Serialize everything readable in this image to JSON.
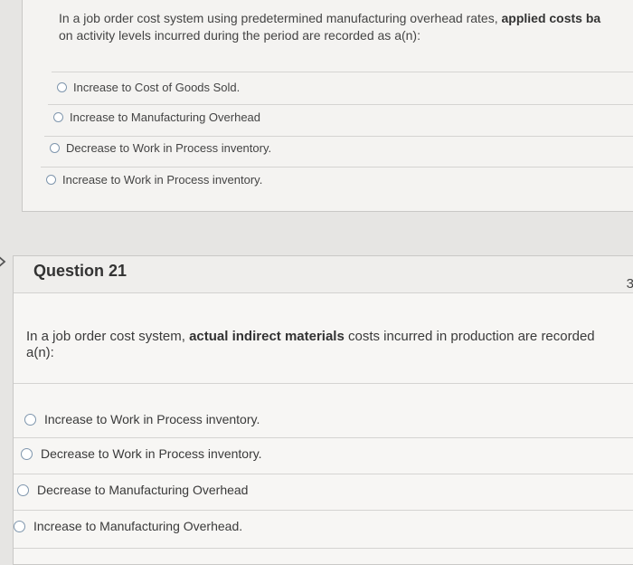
{
  "q20": {
    "prompt_part1": "In a job order cost system using predetermined manufacturing overhead rates, ",
    "prompt_bold": "applied costs ba",
    "prompt_part2": "on activity levels incurred during the period are recorded as a(n):",
    "options": [
      "Increase to Cost of Goods Sold.",
      "Increase to Manufacturing Overhead",
      "Decrease to Work in Process inventory.",
      "Increase to Work in Process inventory."
    ]
  },
  "q21": {
    "title": "Question 21",
    "points": "3",
    "prompt_part1": "In a job order cost system, ",
    "prompt_bold": "actual indirect materials",
    "prompt_part2": " costs incurred in production are recorded",
    "prompt_part3": "a(n):",
    "options": [
      "Increase to Work in Process inventory.",
      "Decrease to Work in Process inventory.",
      "Decrease to Manufacturing Overhead",
      "Increase to Manufacturing Overhead."
    ]
  }
}
